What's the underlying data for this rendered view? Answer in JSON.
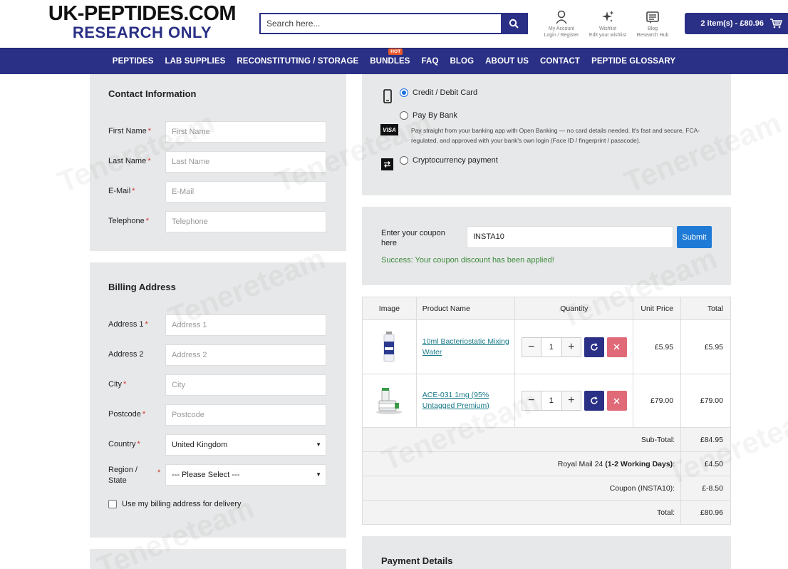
{
  "brand": {
    "line1": "UK-PEPTIDES.COM",
    "line2": "RESEARCH ONLY"
  },
  "search": {
    "placeholder": "Search here..."
  },
  "header_links": [
    {
      "label": "My Account",
      "sub": "Login / Register",
      "icon": "user-icon"
    },
    {
      "label": "Wishlist",
      "sub": "Edit your wishlist",
      "icon": "sparkle-icon"
    },
    {
      "label": "Blog",
      "sub": "Research Hub",
      "icon": "blog-icon"
    }
  ],
  "cart": {
    "label": "2 item(s) - £80.96"
  },
  "nav": {
    "items": [
      "PEPTIDES",
      "LAB SUPPLIES",
      "RECONSTITUTING / STORAGE",
      "BUNDLES",
      "FAQ",
      "BLOG",
      "ABOUT US",
      "CONTACT",
      "PEPTIDE GLOSSARY"
    ],
    "hot_badge": "HOT"
  },
  "contact": {
    "title": "Contact Information",
    "fields": [
      {
        "label": "First Name",
        "placeholder": "First Name"
      },
      {
        "label": "Last Name",
        "placeholder": "Last Name"
      },
      {
        "label": "E-Mail",
        "placeholder": "E-Mail"
      },
      {
        "label": "Telephone",
        "placeholder": "Telephone"
      }
    ]
  },
  "billing": {
    "title": "Billing Address",
    "fields": [
      {
        "label": "Address 1",
        "placeholder": "Address 1"
      },
      {
        "label": "Address 2",
        "placeholder": "Address 2"
      },
      {
        "label": "City",
        "placeholder": "City"
      },
      {
        "label": "Postcode",
        "placeholder": "Postcode"
      }
    ],
    "country_label": "Country",
    "country_value": "United Kingdom",
    "region_label_1": "Region /",
    "region_label_2": "State",
    "region_value": "--- Please Select ---",
    "use_billing_label": "Use my billing address for delivery",
    "required_mark": "*"
  },
  "payment": {
    "options": [
      {
        "label": "Credit / Debit Card",
        "selected": true
      },
      {
        "label": "Pay By Bank",
        "selected": false
      },
      {
        "label": "Cryptocurrency payment",
        "selected": false
      }
    ],
    "visa_text": "VISA",
    "bank_description": "Pay straight from your banking app with Open Banking — no card details needed. It's fast and secure, FCA-regulated, and approved with your bank's own login (Face ID / fingerprint / passcode)."
  },
  "coupon": {
    "label": "Enter your coupon here",
    "value": "INSTA10",
    "button": "Submit",
    "message": "Success: Your coupon discount has been applied!"
  },
  "cart_table": {
    "headers": [
      "Image",
      "Product Name",
      "Quantity",
      "Unit Price",
      "Total"
    ],
    "rows": [
      {
        "name": "10ml Bacteriostatic Mixing Water",
        "qty": "1",
        "unit": "£5.95",
        "total": "£5.95"
      },
      {
        "name": "ACE-031 1mg (95% Untagged Premium)",
        "qty": "1",
        "unit": "£79.00",
        "total": "£79.00"
      }
    ],
    "totals": [
      {
        "label": "Sub-Total:",
        "value": "£84.95"
      },
      {
        "label_prefix": "Royal Mail 24 ",
        "label_bold": "(1-2 Working Days)",
        "label_suffix": ":",
        "value": "£4.50"
      },
      {
        "label": "Coupon (INSTA10):",
        "value": "£-8.50"
      },
      {
        "label": "Total:",
        "value": "£80.96"
      }
    ]
  },
  "payment_details": {
    "title": "Payment Details"
  },
  "watermark": "Tenereteam",
  "colors": {
    "brand_navy": "#2a3085",
    "hot": "#e8582c",
    "submit_blue": "#1f7bd6",
    "success_green": "#3c8a3c",
    "remove_pink": "#e06a78"
  }
}
